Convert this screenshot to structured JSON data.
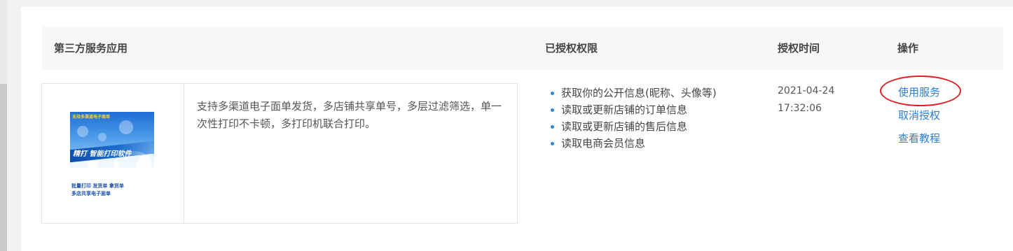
{
  "table": {
    "headers": {
      "app": "第三方服务应用",
      "permissions": "已授权权限",
      "auth_time": "授权时间",
      "actions": "操作"
    }
  },
  "row": {
    "app_image": {
      "top_text": "支持多渠道电子面单",
      "band_text": "精打 智能打印软件",
      "caption_line1": "批量打印 发货单 拿货单",
      "caption_line2": "多店共享电子面单"
    },
    "description": "支持多渠道电子面单发货，多店铺共享单号，多层过滤筛选，单一次性打印不卡顿，多打印机联合打印。",
    "permissions": [
      "获取你的公开信息(昵称、头像等)",
      "读取或更新店铺的订单信息",
      "读取或更新店铺的售后信息",
      "读取电商会员信息"
    ],
    "auth_date": "2021-04-24",
    "auth_clock": "17:32:06",
    "actions": {
      "use_service": "使用服务",
      "revoke": "取消授权",
      "tutorial": "查看教程"
    }
  },
  "colors": {
    "link": "#2b7fd3",
    "bullet": "#2b8ad8",
    "highlight": "#e02020",
    "header_bg": "#f7f7f7"
  }
}
